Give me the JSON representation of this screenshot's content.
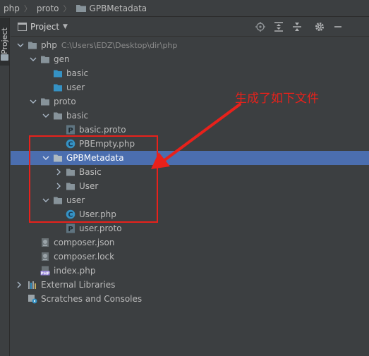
{
  "breadcrumb": {
    "items": [
      "php",
      "proto",
      "GPBMetadata"
    ]
  },
  "side_tab": {
    "label": "Project"
  },
  "tool_window": {
    "title": "Project",
    "buttons": [
      "locate-icon",
      "expand-all-icon",
      "collapse-all-icon",
      "gear-icon",
      "minimize-icon"
    ]
  },
  "tree": {
    "root": {
      "label": "php",
      "path": "C:\\Users\\EDZ\\Desktop\\dir\\php"
    },
    "gen": {
      "label": "gen"
    },
    "gen_basic": {
      "label": "basic"
    },
    "gen_user": {
      "label": "user"
    },
    "proto": {
      "label": "proto"
    },
    "proto_basic": {
      "label": "basic"
    },
    "basic_proto": {
      "label": "basic.proto"
    },
    "pbempty": {
      "label": "PBEmpty.php"
    },
    "gpbmetadata": {
      "label": "GPBMetadata"
    },
    "gpb_basic": {
      "label": "Basic"
    },
    "gpb_user": {
      "label": "User"
    },
    "proto_user": {
      "label": "user"
    },
    "user_php": {
      "label": "User.php"
    },
    "user_proto": {
      "label": "user.proto"
    },
    "composer_json": {
      "label": "composer.json"
    },
    "composer_lock": {
      "label": "composer.lock"
    },
    "index_php": {
      "label": "index.php"
    },
    "external_libraries": {
      "label": "External Libraries"
    },
    "scratches": {
      "label": "Scratches and Consoles"
    }
  },
  "annotation": {
    "text": "生成了如下文件",
    "color": "#e8211b"
  },
  "colors": {
    "background": "#3c3f41",
    "selection": "#4b6eaf",
    "folder": "#87939a",
    "folder_blue": "#3592c4",
    "php_class": "#3592c4",
    "proto_file": "#6f8f9f"
  }
}
